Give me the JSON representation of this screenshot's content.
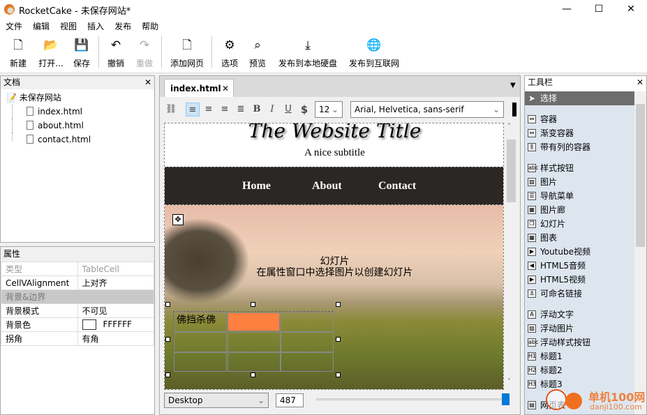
{
  "window": {
    "title": "RocketCake - 未保存网站*",
    "minimize": "—",
    "maximize": "☐",
    "close": "✕"
  },
  "menu": [
    "文件",
    "编辑",
    "视图",
    "插入",
    "发布",
    "帮助"
  ],
  "toolbar": [
    {
      "label": "新建",
      "icon": "new-file-icon",
      "glyph": "🗋"
    },
    {
      "label": "打开...",
      "icon": "open-folder-icon",
      "glyph": "📂"
    },
    {
      "label": "保存",
      "icon": "save-icon",
      "glyph": "💾"
    },
    {
      "label": "撤销",
      "icon": "undo-icon",
      "glyph": "↶"
    },
    {
      "label": "重做",
      "icon": "redo-icon",
      "glyph": "↷",
      "disabled": true
    },
    {
      "label": "添加网页",
      "icon": "add-page-icon",
      "glyph": "🗋"
    },
    {
      "label": "选项",
      "icon": "gear-icon",
      "glyph": "⚙"
    },
    {
      "label": "预览",
      "icon": "preview-icon",
      "glyph": "⌕"
    },
    {
      "label": "发布到本地硬盘",
      "icon": "publish-disk-icon",
      "glyph": "⤓"
    },
    {
      "label": "发布到互联网",
      "icon": "publish-web-icon",
      "glyph": "🌐"
    }
  ],
  "documents": {
    "title": "文档",
    "close": "✕",
    "root": "未保存网站",
    "files": [
      "index.html",
      "about.html",
      "contact.html"
    ]
  },
  "properties": {
    "title": "属性",
    "rows": [
      {
        "name": "类型",
        "value": "TableCell",
        "style": "grey"
      },
      {
        "name": "CellVAlignment",
        "value": "上对齐"
      },
      {
        "section": "背景&边界"
      },
      {
        "name": "背景模式",
        "value": "不可见"
      },
      {
        "name": "背景色",
        "value": "FFFFFF",
        "swatch": "#FFFFFF"
      },
      {
        "name": "拐角",
        "value": "有角"
      }
    ]
  },
  "editor": {
    "tab": "index.html",
    "tab_close": "✕",
    "format": {
      "font_size": "12",
      "font_family": "Arial, Helvetica, sans-serif",
      "bold": "B",
      "italic": "I",
      "underline": "U",
      "dollar": "$",
      "alignment": "left"
    },
    "page": {
      "site_title": "The Website Title",
      "subtitle": "A nice subtitle",
      "nav": [
        "Home",
        "About",
        "Contact"
      ],
      "slideshow_title": "幻灯片",
      "slideshow_hint": "在属性窗口中选择图片以创建幻灯片",
      "cell_text": "佛挡杀佛",
      "cell_highlight": "#FF7F41"
    },
    "device": "Desktop",
    "width": "487",
    "width_slider": 1.0
  },
  "tools": {
    "title": "工具栏",
    "close": "✕",
    "selected": "选择",
    "groups": [
      [
        "容器",
        "渐变容器",
        "带有列的容器"
      ],
      [
        "样式按钮",
        "图片",
        "导航菜单",
        "图片廊",
        "幻灯片",
        "图表",
        "Youtube视频",
        "HTML5音频",
        "HTML5视频",
        "可命名链接"
      ],
      [
        "浮动文字",
        "浮动图片",
        "浮动样式按钮",
        "标题1",
        "标题2",
        "标题3"
      ],
      [
        "网页表"
      ]
    ]
  },
  "watermark": {
    "text": "单机100网",
    "url": "danji100.com"
  }
}
